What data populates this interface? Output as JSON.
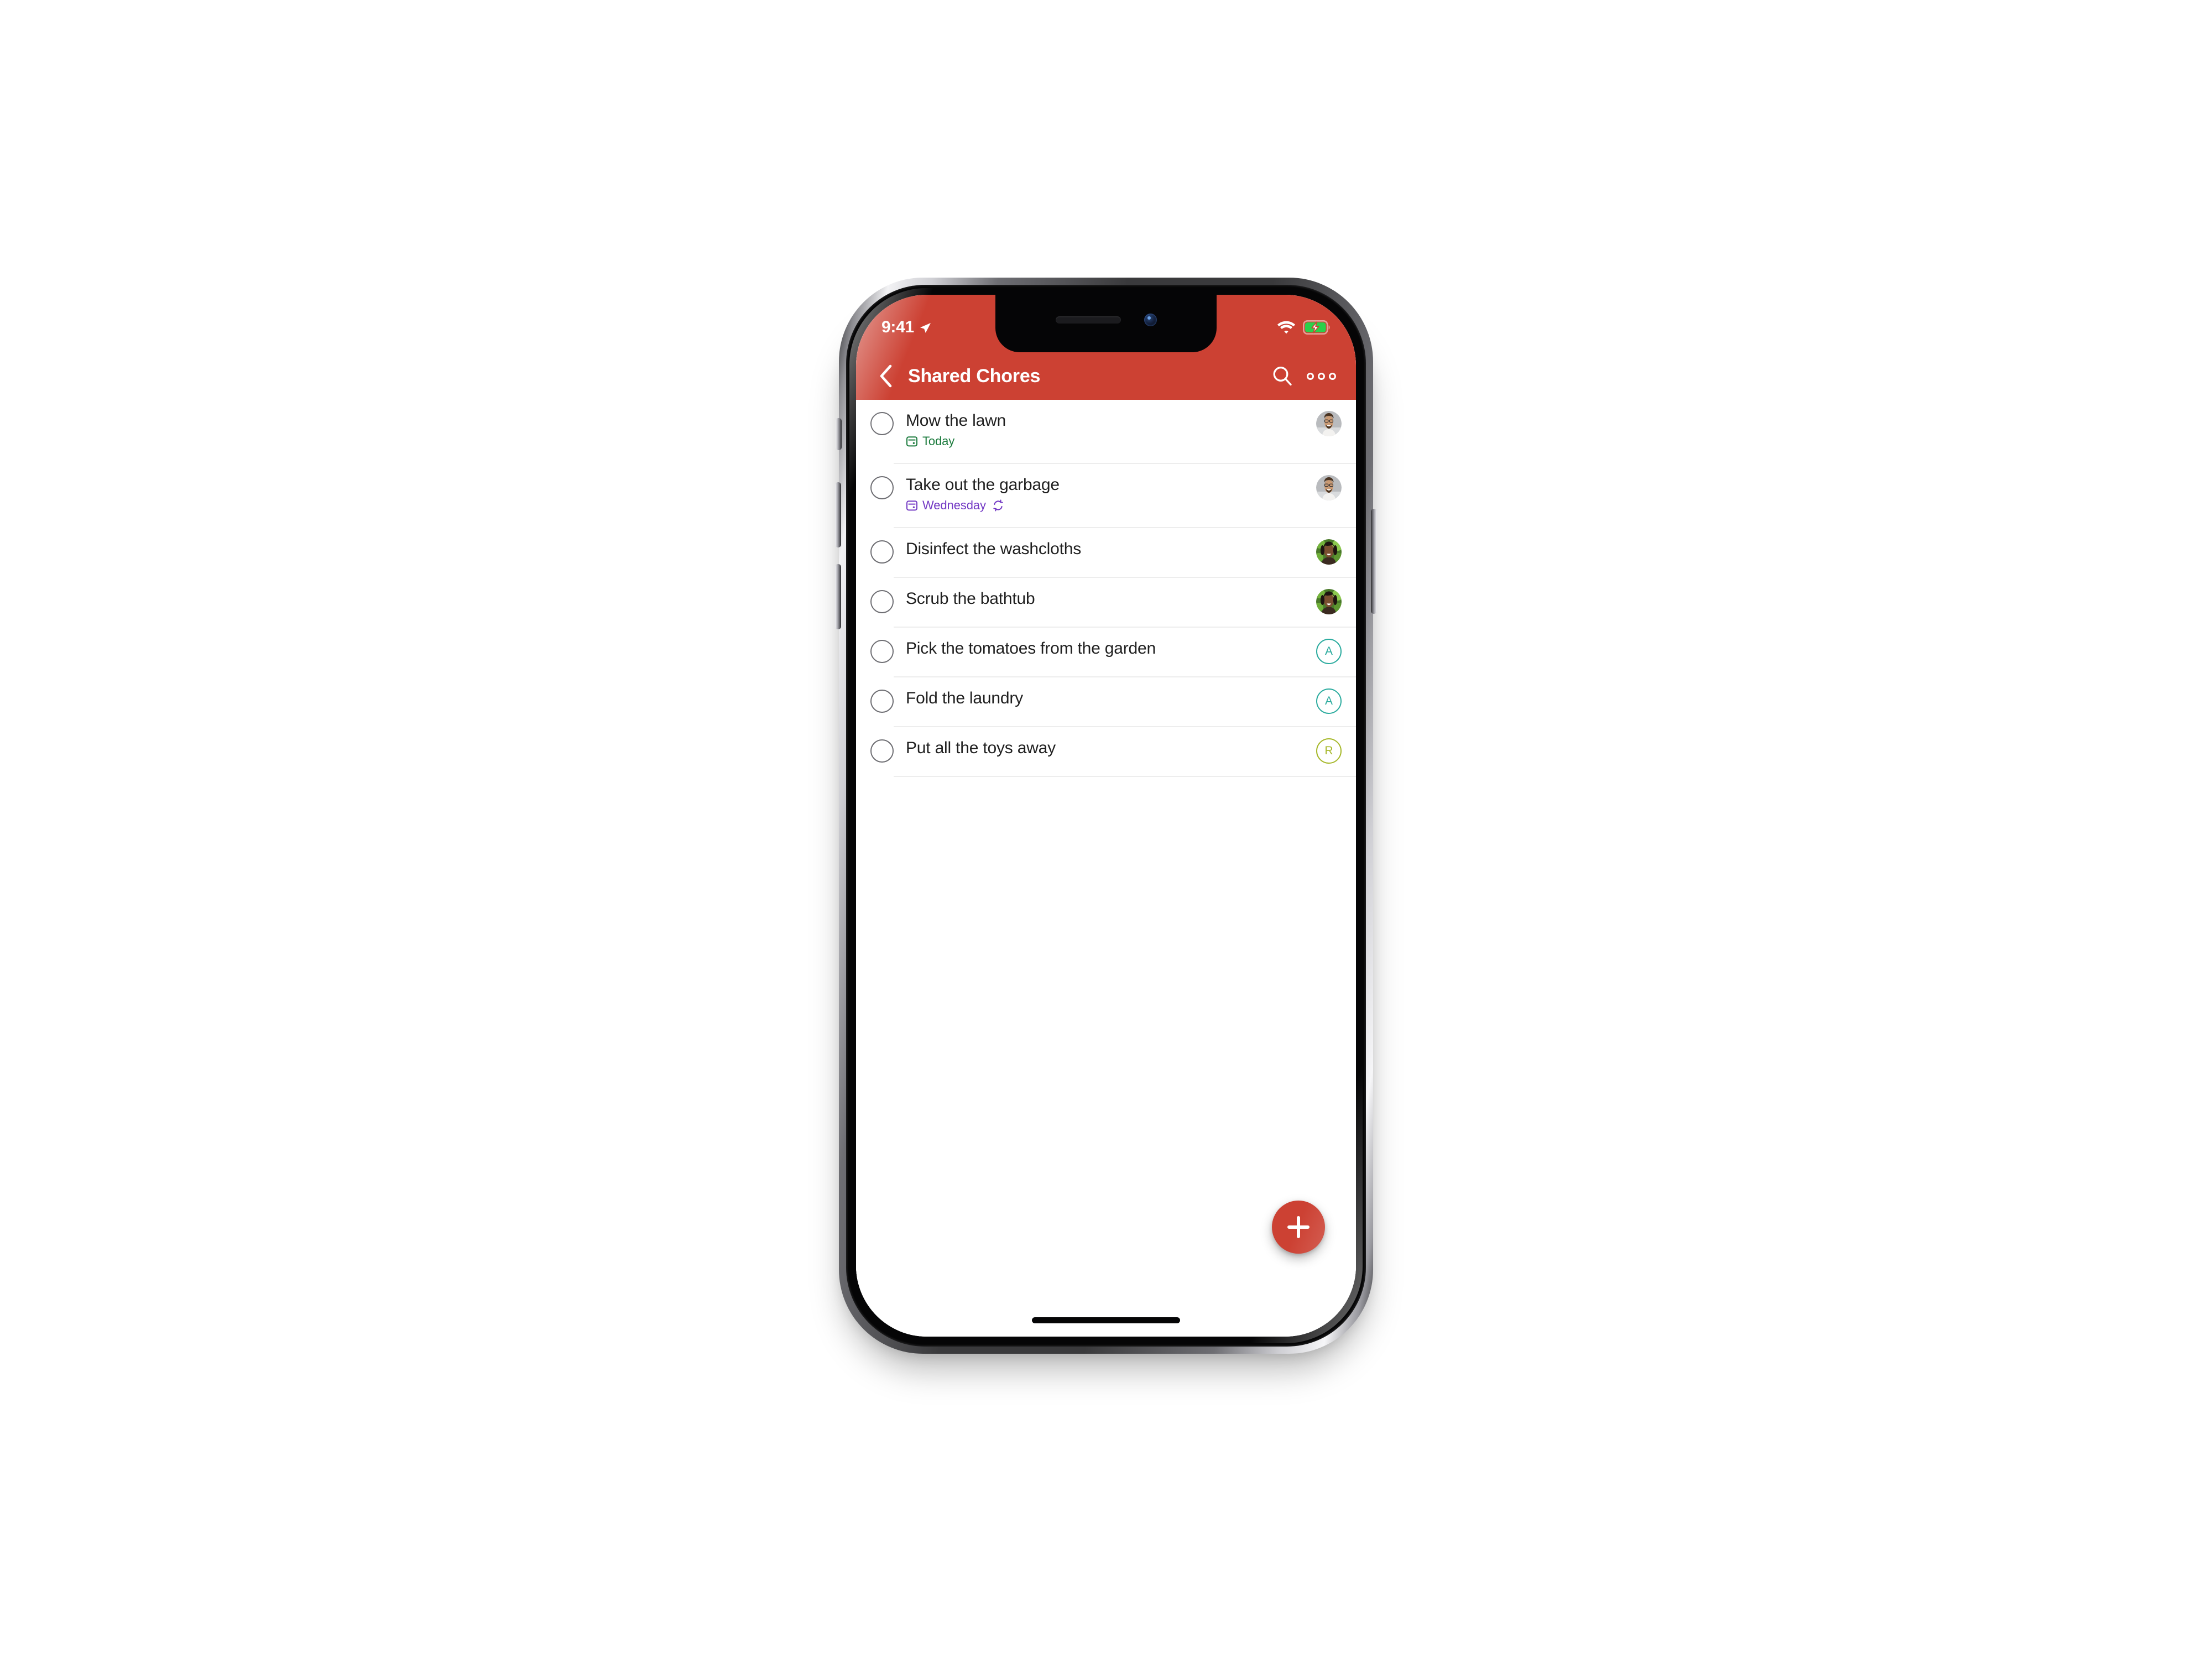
{
  "device": {
    "name": "iphone-x-mockup",
    "frame_color": "#2c2c2e"
  },
  "status_bar": {
    "time": "9:41",
    "location_icon": "location-arrow-icon",
    "wifi_icon": "wifi-icon",
    "battery_icon": "battery-charging-icon",
    "battery_charging": true,
    "battery_color": "#2bd04a"
  },
  "header": {
    "background_color": "#cc4133",
    "back_icon": "chevron-left-icon",
    "title": "Shared Chores",
    "search_icon": "search-icon",
    "more_icon": "more-horizontal-icon"
  },
  "colors": {
    "accent_red": "#cc4133",
    "today_green": "#1a7a3c",
    "recurring_purple": "#7339c4",
    "avatar_teal": "#2bab9e",
    "avatar_olive": "#a6b82a",
    "separator": "#ededed",
    "title_text": "#1f1f1f",
    "checkbox_border": "#6d6d72"
  },
  "tasks": [
    {
      "title": "Mow the lawn",
      "checked": false,
      "due_label": "Today",
      "due_color": "#1a7a3c",
      "date_icon": "calendar-icon",
      "recurring": false,
      "assignee": {
        "type": "photo",
        "photo": "man-with-glasses-beard",
        "initial": ""
      }
    },
    {
      "title": "Take out the garbage",
      "checked": false,
      "due_label": "Wednesday",
      "due_color": "#7339c4",
      "date_icon": "calendar-icon",
      "recurring": true,
      "recurring_icon": "repeat-icon",
      "assignee": {
        "type": "photo",
        "photo": "man-with-glasses-beard",
        "initial": ""
      }
    },
    {
      "title": "Disinfect the washcloths",
      "checked": false,
      "due_label": "",
      "due_color": "",
      "date_icon": "",
      "recurring": false,
      "assignee": {
        "type": "photo",
        "photo": "woman-dark-hair-green-foliage",
        "initial": ""
      }
    },
    {
      "title": "Scrub the bathtub",
      "checked": false,
      "due_label": "",
      "due_color": "",
      "date_icon": "",
      "recurring": false,
      "assignee": {
        "type": "photo",
        "photo": "woman-dark-hair-green-foliage",
        "initial": ""
      }
    },
    {
      "title": "Pick the tomatoes from the garden",
      "checked": false,
      "due_label": "",
      "due_color": "",
      "date_icon": "",
      "recurring": false,
      "assignee": {
        "type": "initial",
        "photo": "",
        "initial": "A",
        "color": "#2bab9e"
      }
    },
    {
      "title": "Fold the laundry",
      "checked": false,
      "due_label": "",
      "due_color": "",
      "date_icon": "",
      "recurring": false,
      "assignee": {
        "type": "initial",
        "photo": "",
        "initial": "A",
        "color": "#2bab9e"
      }
    },
    {
      "title": "Put all the toys away",
      "checked": false,
      "due_label": "",
      "due_color": "",
      "date_icon": "",
      "recurring": false,
      "assignee": {
        "type": "initial",
        "photo": "",
        "initial": "R",
        "color": "#a6b82a"
      }
    }
  ],
  "fab": {
    "icon": "plus-icon",
    "label": "+",
    "color": "#cc4133"
  },
  "home_indicator": "home-indicator"
}
